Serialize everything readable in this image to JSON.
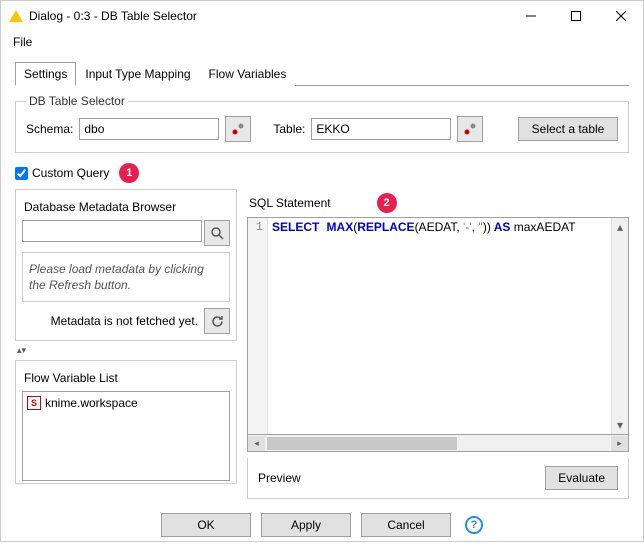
{
  "window": {
    "title": "Dialog - 0:3 - DB Table Selector"
  },
  "menubar": {
    "file": "File"
  },
  "tabs": {
    "settings": "Settings",
    "input_mapping": "Input Type Mapping",
    "flow_vars": "Flow Variables"
  },
  "selector": {
    "legend": "DB Table Selector",
    "schema_label": "Schema:",
    "schema_value": "dbo",
    "table_label": "Table:",
    "table_value": "EKKO",
    "select_table_btn": "Select a table"
  },
  "custom_query": {
    "label": "Custom Query",
    "checked": true
  },
  "badges": {
    "one": "1",
    "two": "2"
  },
  "metadata": {
    "title": "Database Metadata Browser",
    "hint": "Please load metadata by clicking the Refresh button.",
    "status": "Metadata is not fetched yet."
  },
  "flowvar": {
    "title": "Flow Variable List",
    "items": [
      "knime.workspace"
    ]
  },
  "sql": {
    "title": "SQL Statement",
    "line_no": "1",
    "tokens": {
      "select": "SELECT",
      "max": "MAX",
      "open1": "(",
      "replace": "REPLACE",
      "args": "(AEDAT, ",
      "str1": "'-'",
      "comma": ", ",
      "str2": "''",
      "close": "))",
      "as": " AS ",
      "alias": "maxAEDAT"
    }
  },
  "preview": {
    "label": "Preview",
    "evaluate_btn": "Evaluate"
  },
  "footer": {
    "ok": "OK",
    "apply": "Apply",
    "cancel": "Cancel"
  }
}
